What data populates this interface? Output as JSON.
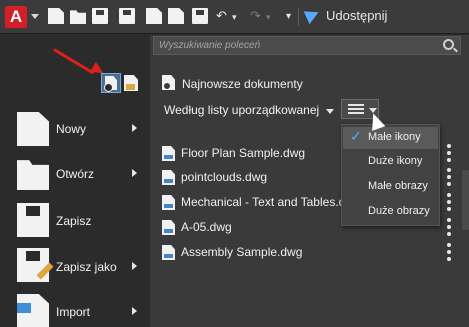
{
  "app": {
    "logo_letter": "A"
  },
  "toolbar": {
    "icons": [
      "new-icon",
      "open-icon",
      "save-icon",
      "save-as-icon",
      "open-web-icon",
      "save-web-icon",
      "plot-icon",
      "undo-icon",
      "redo-icon",
      "customize-icon"
    ],
    "share_label": "Udostępnij"
  },
  "search": {
    "placeholder": "Wyszukiwanie poleceń"
  },
  "recent": {
    "title": "Najnowsze dokumenty",
    "order_label": "Według listy uporządkowanej",
    "files": [
      "Floor Plan Sample.dwg",
      "pointclouds.dwg",
      "Mechanical - Text and Tables.dwg",
      "A-05.dwg",
      "Assembly Sample.dwg"
    ]
  },
  "view_menu": {
    "options": [
      "Małe ikony",
      "Duże ikony",
      "Małe obrazy",
      "Duże obrazy"
    ],
    "selected_index": 0,
    "check": "✓"
  },
  "app_menu": {
    "items": [
      {
        "label": "Nowy",
        "has_submenu": true
      },
      {
        "label": "Otwórz",
        "has_submenu": true
      },
      {
        "label": "Zapisz",
        "has_submenu": false
      },
      {
        "label": "Zapisz jako",
        "has_submenu": true
      },
      {
        "label": "Import",
        "has_submenu": true
      }
    ]
  },
  "colors": {
    "accent": "#5aa9ff",
    "brand_red": "#d51f26",
    "annotation_arrow": "#d9211f"
  }
}
